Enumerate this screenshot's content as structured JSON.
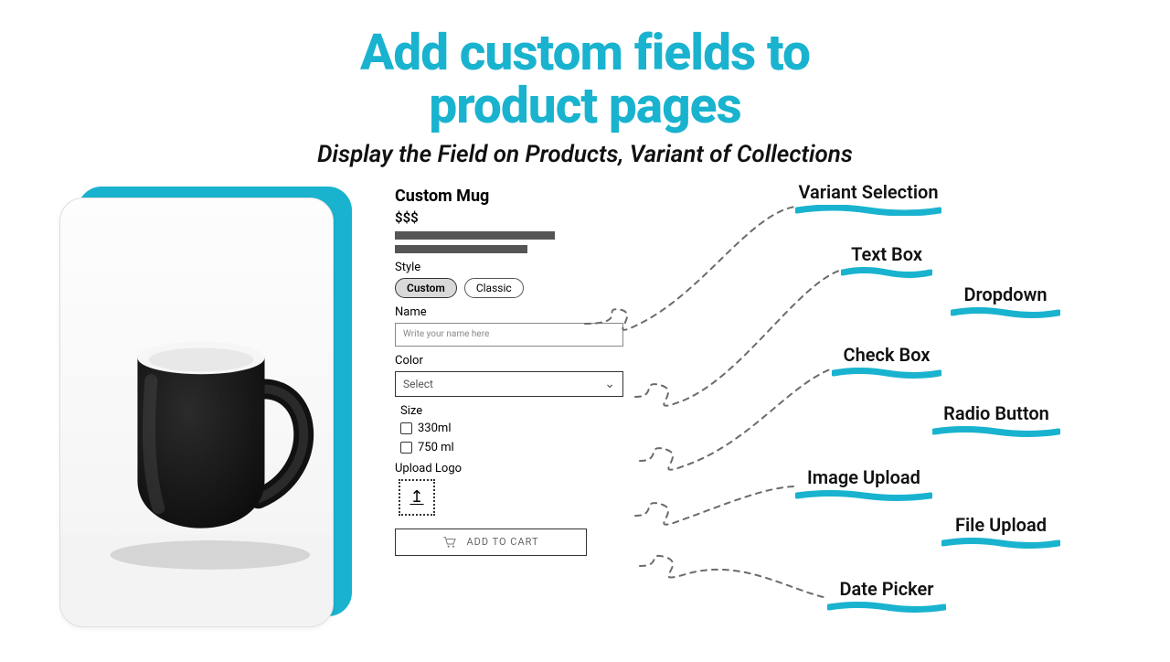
{
  "hero": {
    "title_line1": "Add custom fields to",
    "title_line2": "product pages",
    "subtitle": "Display the Field on Products, Variant of Collections"
  },
  "product": {
    "title": "Custom Mug",
    "price": "$$$",
    "style_label": "Style",
    "style_options": {
      "a": "Custom",
      "b": "Classic"
    },
    "name_label": "Name",
    "name_placeholder": "Write your name here",
    "color_label": "Color",
    "color_placeholder": "Select",
    "size_label": "Size",
    "size_options": {
      "a": "330ml",
      "b": "750 ml"
    },
    "upload_label": "Upload Logo",
    "cart_label": "ADD TO CART"
  },
  "features": {
    "variant": "Variant Selection",
    "textbox": "Text Box",
    "dropdown": "Dropdown",
    "checkbox": "Check Box",
    "radio": "Radio Button",
    "image": "Image Upload",
    "file": "File Upload",
    "date": "Date Picker"
  }
}
